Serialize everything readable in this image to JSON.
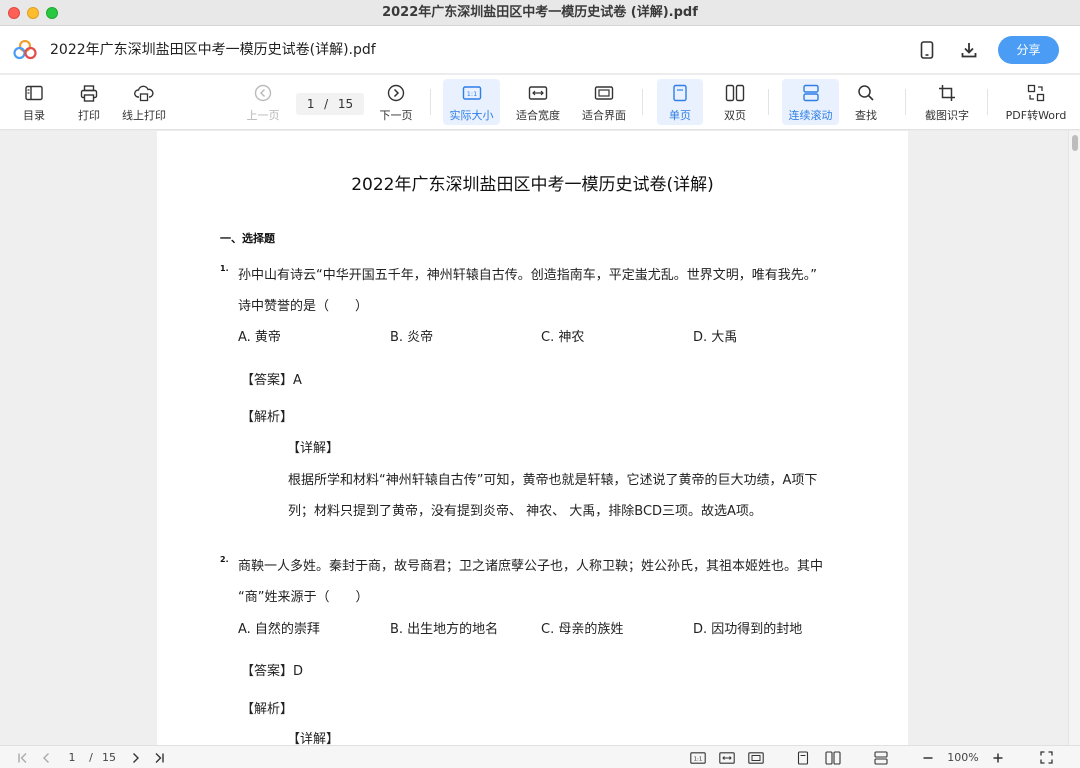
{
  "window": {
    "title": "2022年广东深圳盐田区中考一模历史试卷 (详解).pdf"
  },
  "header": {
    "doc_name": "2022年广东深圳盐田区中考一模历史试卷(详解).pdf",
    "share_label": "分享"
  },
  "toolbar": {
    "toc": "目录",
    "print": "打印",
    "online_print": "线上打印",
    "prev_page": "上一页",
    "next_page": "下一页",
    "current_page": "1",
    "page_sep": "/",
    "total_pages": "15",
    "actual_size": "实际大小",
    "fit_width": "适合宽度",
    "fit_screen": "适合界面",
    "single_page": "单页",
    "double_page": "双页",
    "continuous": "连续滚动",
    "find": "查找",
    "ocr": "截图识字",
    "pdf_to_word": "PDF转Word",
    "active_items": [
      "actual_size",
      "single_page",
      "continuous"
    ]
  },
  "document": {
    "title": "2022年广东深圳盐田区中考一模历史试卷(详解)",
    "section": "一、选择题",
    "q1": {
      "num": "1.",
      "line1": "孙中山有诗云“中华开国五千年，神州轩辕自古传。创造指南车，平定蚩尤乱。世界文明，唯有我先。”",
      "line2": "诗中赞誉的是（　　）",
      "options": [
        "A. 黄帝",
        "B. 炎帝",
        "C. 神农",
        "D. 大禹"
      ],
      "answer": "【答案】A",
      "analysis": "【解析】",
      "detail": "【详解】",
      "detail1": "根据所学和材料“神州轩辕自古传”可知，黄帝也就是轩辕，它述说了黄帝的巨大功绩，A项下",
      "detail2": "列；材料只提到了黄帝，没有提到炎帝、 神农、 大禹，排除BCD三项。故选A项。"
    },
    "q2": {
      "num": "2.",
      "line1": "商鞅一人多姓。秦封于商，故号商君；卫之诸庶孽公子也，人称卫鞅；姓公孙氏，其祖本姬姓也。其中",
      "line2": "“商”姓来源于（　　）",
      "options": [
        "A. 自然的崇拜",
        "B. 出生地方的地名",
        "C. 母亲的族姓",
        "D. 因功得到的封地"
      ],
      "answer": "【答案】D",
      "analysis": "【解析】",
      "detail": "【详解】"
    }
  },
  "statusbar": {
    "current_page": "1",
    "page_sep": "/",
    "total_pages": "15",
    "zoom": "100%"
  },
  "colors": {
    "accent": "#2f7ee8",
    "share": "#4a9cf4",
    "active_bg": "#e8f1fd"
  }
}
